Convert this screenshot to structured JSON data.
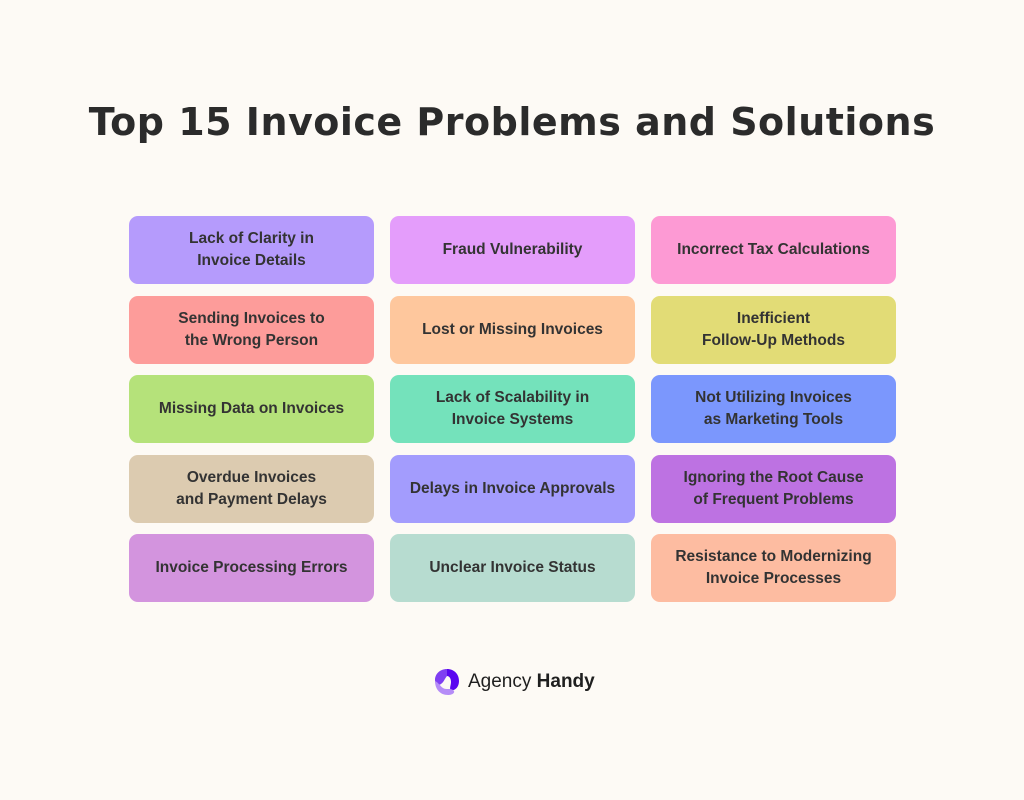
{
  "title": "Top 15 Invoice Problems and Solutions",
  "cards": [
    {
      "label": "Lack of Clarity in\nInvoice Details",
      "color": "#b59bfc"
    },
    {
      "label": "Fraud Vulnerability",
      "color": "#e49dfb"
    },
    {
      "label": "Incorrect Tax Calculations",
      "color": "#fd9ad4"
    },
    {
      "label": "Sending Invoices to\nthe Wrong Person",
      "color": "#fd9c9a"
    },
    {
      "label": "Lost or Missing Invoices",
      "color": "#fec79d"
    },
    {
      "label": "Inefficient\nFollow-Up Methods",
      "color": "#e2dc76"
    },
    {
      "label": "Missing Data on Invoices",
      "color": "#b5e27a"
    },
    {
      "label": "Lack of Scalability in\nInvoice Systems",
      "color": "#74e2bb"
    },
    {
      "label": "Not Utilizing Invoices\nas Marketing Tools",
      "color": "#7b97fd"
    },
    {
      "label": "Overdue Invoices\nand Payment Delays",
      "color": "#dccbb0"
    },
    {
      "label": "Delays in Invoice Approvals",
      "color": "#a39cfd"
    },
    {
      "label": "Ignoring the Root Cause\nof Frequent Problems",
      "color": "#bd72e2"
    },
    {
      "label": "Invoice Processing Errors",
      "color": "#d394de"
    },
    {
      "label": "Unclear Invoice Status",
      "color": "#b7dcd0"
    },
    {
      "label": "Resistance to Modernizing\nInvoice Processes",
      "color": "#fdbca1"
    }
  ],
  "footer": {
    "brand_light": "Agency",
    "brand_bold": "Handy",
    "logo_icon": "agency-handy-logo-icon",
    "logo_colors": [
      "#7f3ff2",
      "#5a06f0",
      "#b58cf7"
    ]
  }
}
